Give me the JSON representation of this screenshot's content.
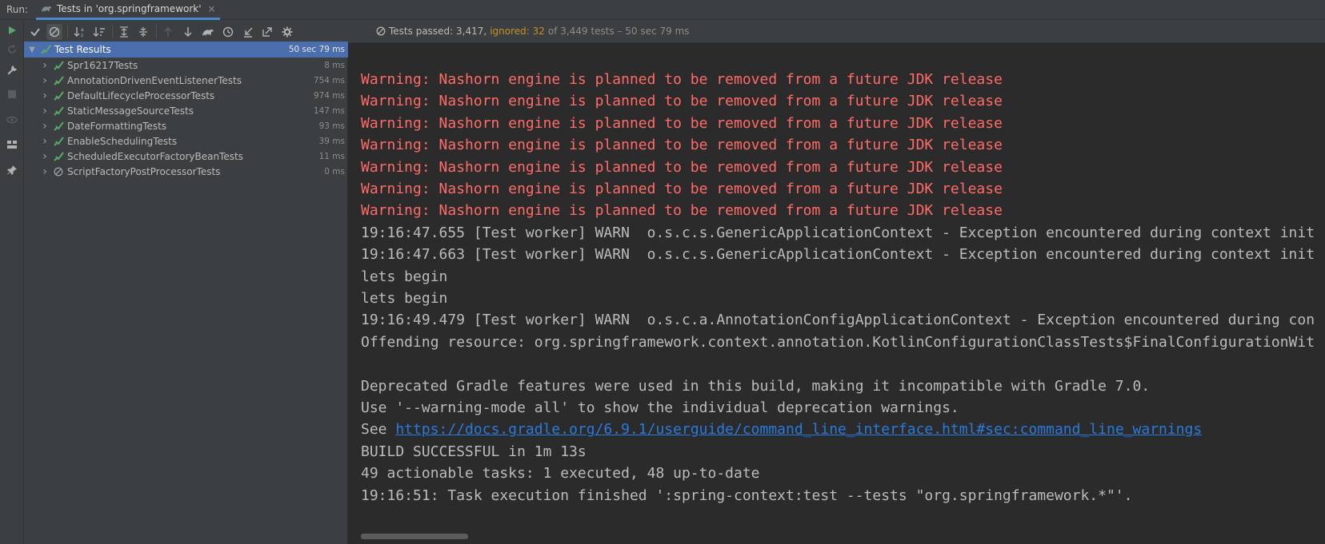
{
  "runbar": {
    "label": "Run:",
    "tab_title": "Tests in 'org.springframework'",
    "tab_close": "×"
  },
  "toolbar": {
    "status_passed": "Tests passed: 3,417,",
    "status_ignored": "ignored: 32",
    "status_rest": "of 3,449 tests – 50 sec 79 ms"
  },
  "tree": {
    "root": {
      "label": "Test Results",
      "time": "50 sec 79 ms"
    },
    "items": [
      {
        "label": "Spr16217Tests",
        "time": "8 ms",
        "status": "passed"
      },
      {
        "label": "AnnotationDrivenEventListenerTests",
        "time": "754 ms",
        "status": "passed"
      },
      {
        "label": "DefaultLifecycleProcessorTests",
        "time": "974 ms",
        "status": "passed"
      },
      {
        "label": "StaticMessageSourceTests",
        "time": "147 ms",
        "status": "passed"
      },
      {
        "label": "DateFormattingTests",
        "time": "93 ms",
        "status": "passed"
      },
      {
        "label": "EnableSchedulingTests",
        "time": "39 ms",
        "status": "passed"
      },
      {
        "label": "ScheduledExecutorFactoryBeanTests",
        "time": "11 ms",
        "status": "passed"
      },
      {
        "label": "ScriptFactoryPostProcessorTests",
        "time": "0 ms",
        "status": "ignored"
      }
    ]
  },
  "console": {
    "lines": [
      "Warning: Nashorn engine is planned to be removed from a future JDK release",
      "Warning: Nashorn engine is planned to be removed from a future JDK release",
      "Warning: Nashorn engine is planned to be removed from a future JDK release",
      "Warning: Nashorn engine is planned to be removed from a future JDK release",
      "Warning: Nashorn engine is planned to be removed from a future JDK release",
      "Warning: Nashorn engine is planned to be removed from a future JDK release",
      "Warning: Nashorn engine is planned to be removed from a future JDK release",
      "19:16:47.655 [Test worker] WARN  o.s.c.s.GenericApplicationContext - Exception encountered during context init",
      "19:16:47.663 [Test worker] WARN  o.s.c.s.GenericApplicationContext - Exception encountered during context init",
      "lets begin",
      "lets begin",
      "19:16:49.479 [Test worker] WARN  o.s.c.a.AnnotationConfigApplicationContext - Exception encountered during con",
      "Offending resource: org.springframework.context.annotation.KotlinConfigurationClassTests$FinalConfigurationWit",
      "",
      "Deprecated Gradle features were used in this build, making it incompatible with Gradle 7.0.",
      "Use '--warning-mode all' to show the individual deprecation warnings.",
      "",
      "BUILD SUCCESSFUL in 1m 13s",
      "49 actionable tasks: 1 executed, 48 up-to-date",
      "19:16:51: Task execution finished ':spring-context:test --tests \"org.springframework.*\"'."
    ],
    "see_prefix": "See ",
    "link_text": "https://docs.gradle.org/6.9.1/userguide/command_line_interface.html#sec:command_line_warnings"
  },
  "colors": {
    "warning": "#ff6b68",
    "link": "#287bde",
    "ignored": "#c69026",
    "pass_green": "#59a869",
    "selection": "#4b6eaf"
  }
}
